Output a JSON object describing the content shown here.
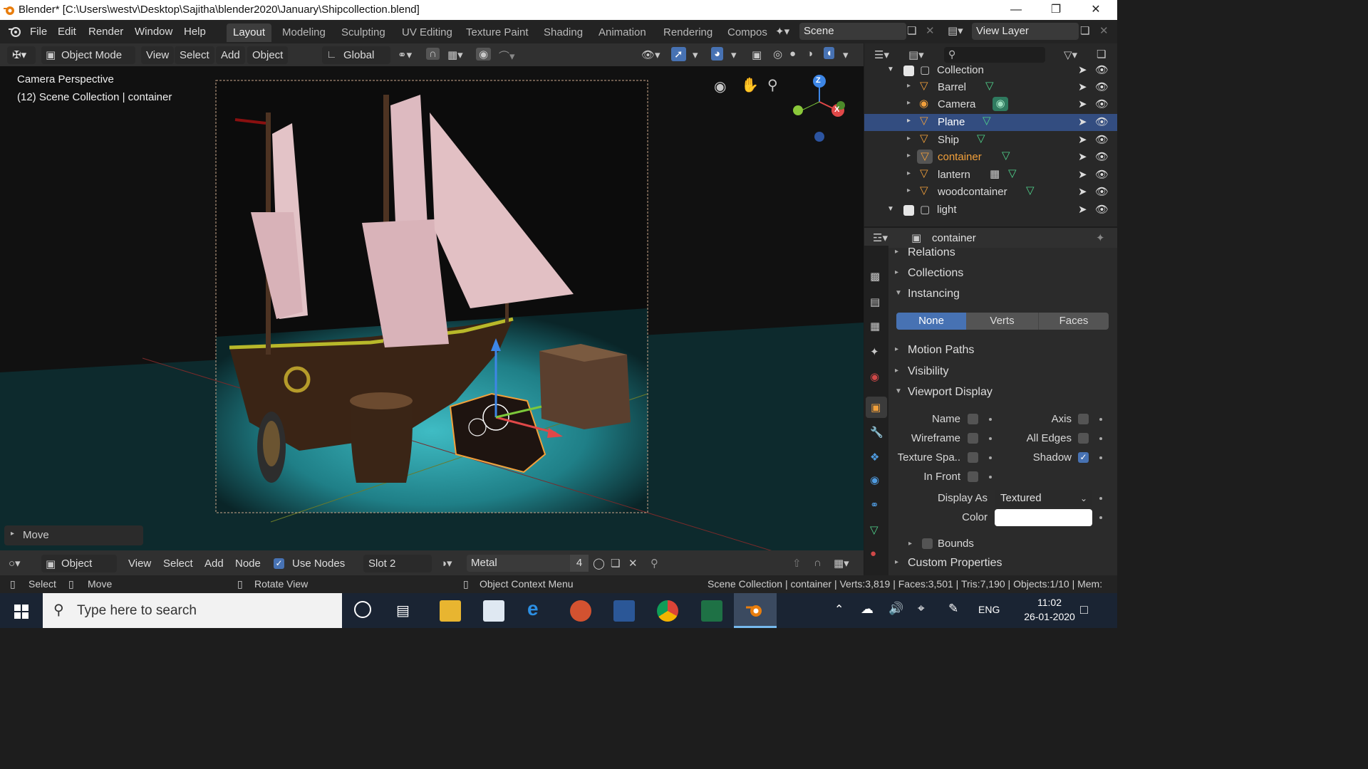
{
  "window": {
    "title": "Blender* [C:\\Users\\westv\\Desktop\\Sajitha\\blender2020\\January\\Shipcollection.blend]"
  },
  "menu": [
    "File",
    "Edit",
    "Render",
    "Window",
    "Help"
  ],
  "workspaces": [
    "Layout",
    "Modeling",
    "Sculpting",
    "UV Editing",
    "Texture Paint",
    "Shading",
    "Animation",
    "Rendering",
    "Compos"
  ],
  "scene": "Scene",
  "view_layer": "View Layer",
  "viewport_header": {
    "mode": "Object Mode",
    "view": "View",
    "select": "Select",
    "add": "Add",
    "object": "Object",
    "orientation": "Global"
  },
  "viewport": {
    "overlay_title": "Camera Perspective",
    "overlay_subtitle": "(12) Scene Collection | container",
    "last_op": "Move",
    "gizmo_z": "Z",
    "gizmo_x": "X"
  },
  "outliner": {
    "collection": "Collection",
    "items": [
      {
        "name": "Barrel"
      },
      {
        "name": "Camera"
      },
      {
        "name": "Plane"
      },
      {
        "name": "Ship"
      },
      {
        "name": "container"
      },
      {
        "name": "lantern"
      },
      {
        "name": "woodcontainer"
      }
    ],
    "collection2": "light"
  },
  "properties": {
    "object_name": "container",
    "relations": "Relations",
    "collections": "Collections",
    "instancing": "Instancing",
    "instancing_options": [
      "None",
      "Verts",
      "Faces"
    ],
    "motion_paths": "Motion Paths",
    "visibility": "Visibility",
    "viewport_display": "Viewport Display",
    "name_label": "Name",
    "axis_label": "Axis",
    "wireframe_label": "Wireframe",
    "all_edges_label": "All Edges",
    "texture_space_label": "Texture Spa..",
    "shadow_label": "Shadow",
    "in_front_label": "In Front",
    "display_as_label": "Display As",
    "display_as_value": "Textured",
    "color_label": "Color",
    "bounds_label": "Bounds",
    "custom_properties": "Custom Properties"
  },
  "node_header": {
    "object": "Object",
    "view": "View",
    "select": "Select",
    "add": "Add",
    "node": "Node",
    "use_nodes": "Use Nodes",
    "slot": "Slot 2",
    "material": "Metal",
    "users": "4"
  },
  "statusbar": {
    "select": "Select",
    "move": "Move",
    "rotate": "Rotate View",
    "context": "Object Context Menu",
    "stats": "Scene Collection | container | Verts:3,819 | Faces:3,501 | Tris:7,190 | Objects:1/10 | Mem:"
  },
  "taskbar": {
    "search_placeholder": "Type here to search",
    "lang": "ENG",
    "time": "11:02",
    "date": "26-01-2020"
  },
  "colors": {
    "accent": "#4772b3",
    "selected_row": "#334d80",
    "active_object": "#f2a03b"
  }
}
